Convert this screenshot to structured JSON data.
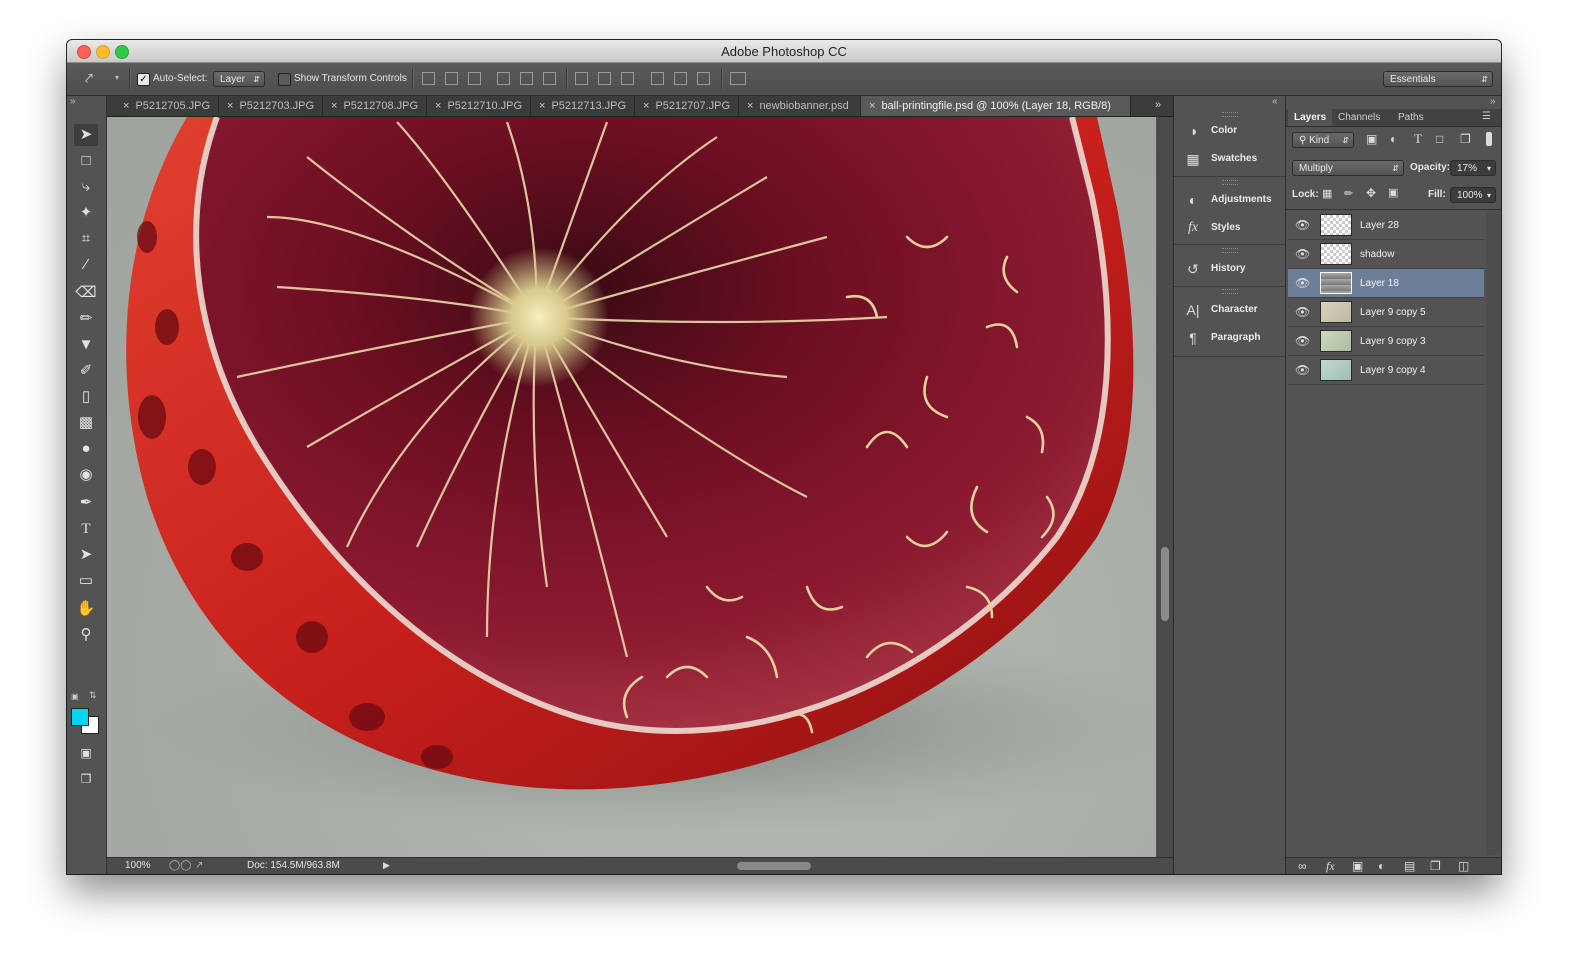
{
  "window": {
    "title": "Adobe Photoshop CC"
  },
  "options_bar": {
    "auto_select_label": "Auto-Select:",
    "auto_select_target": "Layer",
    "show_transform_label": "Show Transform Controls",
    "workspace": "Essentials"
  },
  "tabs": [
    {
      "label": "P5212705.JPG"
    },
    {
      "label": "P5212703.JPG"
    },
    {
      "label": "P5212708.JPG"
    },
    {
      "label": "P5212710.JPG"
    },
    {
      "label": "P5212713.JPG"
    },
    {
      "label": "P5212707.JPG"
    },
    {
      "label": "newbiobanner.psd"
    },
    {
      "label": "ball-printingfile.psd @ 100% (Layer 18, RGB/8)"
    }
  ],
  "status": {
    "zoom": "100%",
    "doc": "Doc: 154.5M/963.8M"
  },
  "mid_panel": {
    "items": [
      {
        "label": "Color",
        "icon": "color-icon"
      },
      {
        "label": "Swatches",
        "icon": "swatches-icon"
      },
      {
        "label": "Adjustments",
        "icon": "adjustments-icon"
      },
      {
        "label": "Styles",
        "icon": "styles-icon"
      },
      {
        "label": "History",
        "icon": "history-icon"
      },
      {
        "label": "Character",
        "icon": "character-icon"
      },
      {
        "label": "Paragraph",
        "icon": "paragraph-icon"
      }
    ]
  },
  "layers_panel": {
    "tabs": [
      "Layers",
      "Channels",
      "Paths"
    ],
    "filter_kind": "Kind",
    "blend_mode": "Multiply",
    "opacity_label": "Opacity:",
    "opacity": "17%",
    "lock_label": "Lock:",
    "fill_label": "Fill:",
    "fill": "100%",
    "layers": [
      {
        "name": "Layer 28"
      },
      {
        "name": "shadow"
      },
      {
        "name": "Layer 18"
      },
      {
        "name": "Layer 9 copy 5"
      },
      {
        "name": "Layer 9 copy 3"
      },
      {
        "name": "Layer 9 copy 4"
      }
    ]
  },
  "colors": {
    "foreground": "#00d8f0",
    "background": "#ffffff",
    "selected_layer": "#6d7f98"
  }
}
